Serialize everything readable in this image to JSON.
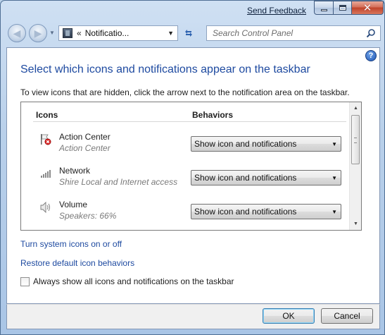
{
  "window": {
    "send_feedback": "Send Feedback"
  },
  "nav": {
    "address_chevron": "«",
    "address_text": "Notificatio...",
    "search_placeholder": "Search Control Panel"
  },
  "page": {
    "title": "Select which icons and notifications appear on the taskbar",
    "intro": "To view icons that are hidden, click the arrow next to the notification area on the taskbar."
  },
  "table": {
    "col_icons": "Icons",
    "col_behaviors": "Behaviors",
    "rows": [
      {
        "name": "Action Center",
        "sub": "Action Center",
        "icon": "action-center-flag-icon",
        "behavior": "Show icon and notifications"
      },
      {
        "name": "Network",
        "sub": "Shire Local and Internet access",
        "icon": "network-bars-icon",
        "behavior": "Show icon and notifications"
      },
      {
        "name": "Volume",
        "sub": "Speakers: 66%",
        "icon": "speaker-icon",
        "behavior": "Show icon and notifications"
      }
    ]
  },
  "links": {
    "system_icons": "Turn system icons on or off",
    "restore": "Restore default icon behaviors"
  },
  "checkbox": {
    "label": "Always show all icons and notifications on the taskbar",
    "checked": false
  },
  "buttons": {
    "ok": "OK",
    "cancel": "Cancel"
  }
}
